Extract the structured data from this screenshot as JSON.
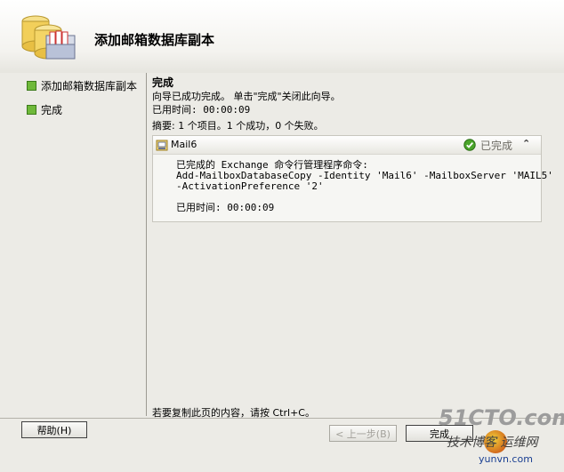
{
  "header": {
    "title": "添加邮箱数据库副本",
    "icon": "database-copy-wizard-icon"
  },
  "sidebar": {
    "items": [
      {
        "label": "添加邮箱数据库副本",
        "state": "completed"
      },
      {
        "label": "完成",
        "state": "current"
      }
    ]
  },
  "content": {
    "title": "完成",
    "description": "向导已成功完成。 单击\"完成\"关闭此向导。",
    "elapsed": "已用时间: 00:00:09",
    "summary": "摘要: 1 个项目。1 个成功，0 个失败。"
  },
  "result_panel": {
    "server": "Mail6",
    "status": "已完成",
    "status_icon": "check-circle-icon",
    "collapse_icon": "double-chevron-up-icon",
    "command_intro": "已完成的 Exchange 命令行管理程序命令:",
    "command_line1": "Add-MailboxDatabaseCopy -Identity 'Mail6' -MailboxServer 'MAIL5'",
    "command_line2": "-ActivationPreference '2'",
    "elapsed": "已用时间: 00:00:09"
  },
  "footer": {
    "copy_hint": "若要复制此页的内容，请按 Ctrl+C。",
    "help_button": "帮助(H)",
    "back_button": "< 上一步(B)",
    "finish_button": "完成"
  },
  "watermark": {
    "brand": "51CTO.com",
    "line2": "技术博客 运维网",
    "domain": "yunvn.com"
  },
  "colors": {
    "step_marker": "#6fb93a",
    "status_text": "#6d6b64"
  }
}
